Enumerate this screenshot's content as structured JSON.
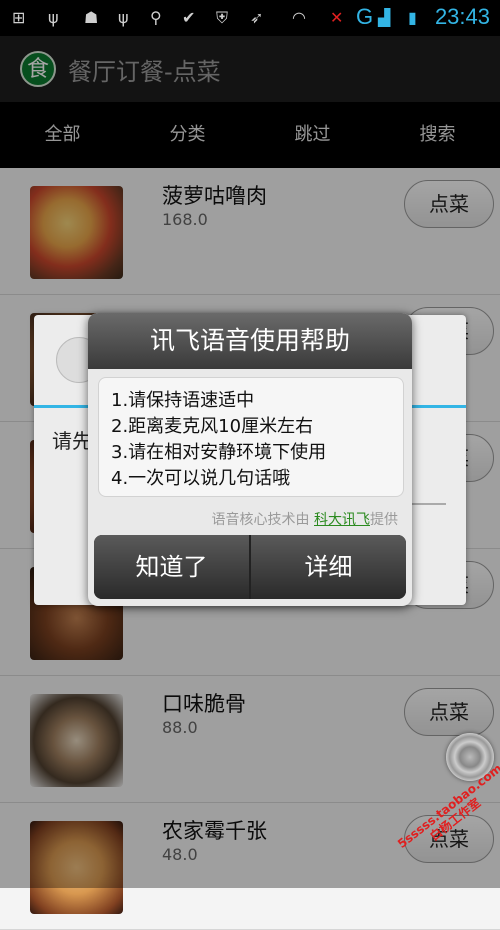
{
  "status_bar": {
    "time": "23:43",
    "network_label": "G",
    "icons": [
      "plus-icon",
      "usb-icon",
      "android-debug-icon",
      "usb-icon",
      "search-icon",
      "check-circle-icon",
      "shield-icon",
      "bird-icon",
      "wifi-icon",
      "signal-x-icon",
      "signal-bars-icon",
      "battery-charging-icon"
    ]
  },
  "app_bar": {
    "logo_char": "食",
    "title": "餐厅订餐-点菜"
  },
  "tabs": [
    {
      "label": "全部"
    },
    {
      "label": "分类"
    },
    {
      "label": "跳过"
    },
    {
      "label": "搜索"
    }
  ],
  "menu": {
    "order_label": "点菜",
    "items": [
      {
        "name": "菠萝咕噜肉",
        "price": "168.0"
      },
      {
        "name": "",
        "price": ""
      },
      {
        "name": "",
        "price": ""
      },
      {
        "name": "",
        "price": ""
      },
      {
        "name": "口味脆骨",
        "price": "88.0"
      },
      {
        "name": "农家霉千张",
        "price": "48.0"
      }
    ]
  },
  "behind_dialog": {
    "prompt_text": "请先"
  },
  "help_dialog": {
    "title": "讯飞语音使用帮助",
    "lines": [
      "1.请保持语速适中",
      "2.距离麦克风10厘米左右",
      "3.请在相对安静环境下使用",
      "4.一次可以说几句话哦"
    ],
    "powered_prefix": "语音核心技术由 ",
    "powered_link": "科大讯飞",
    "powered_suffix": "提供",
    "ok_label": "知道了",
    "detail_label": "详细"
  },
  "watermark": {
    "line1": "5sssss.taobao.com",
    "line2": "白杨工作室"
  },
  "colors": {
    "accent": "#33b5e5",
    "logo_green": "#0b7a2e",
    "link_green": "#2b8a1f"
  }
}
